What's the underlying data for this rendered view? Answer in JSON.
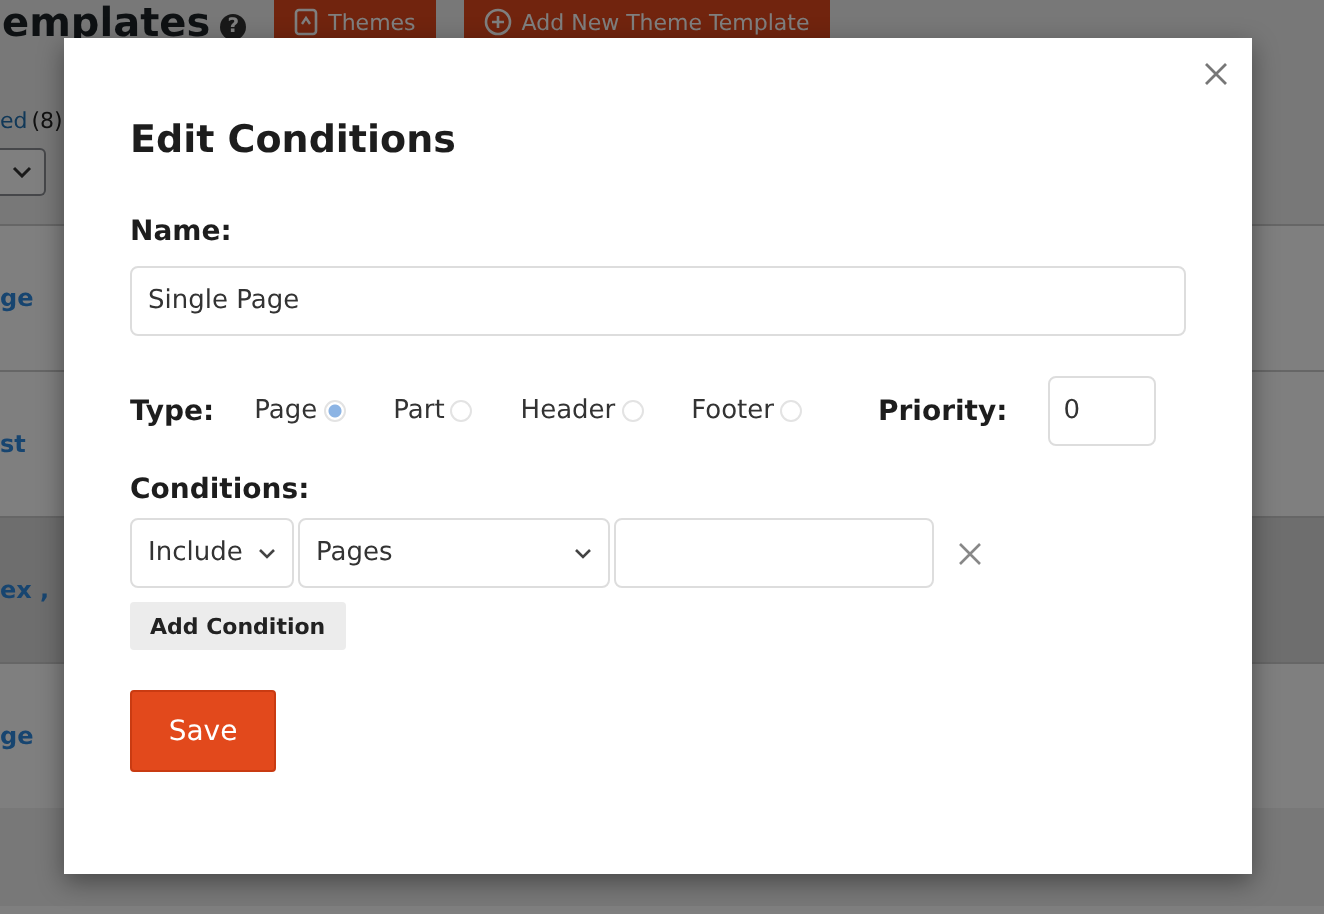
{
  "page": {
    "title": "emplates",
    "help_mark": "?",
    "buttons": [
      {
        "label": "Themes"
      },
      {
        "label": "Add New Theme Template"
      }
    ],
    "filter_link": "ed",
    "filter_count": "(8)",
    "rows": [
      {
        "title": "ge",
        "shaded": false
      },
      {
        "title": "st",
        "shaded": false
      },
      {
        "title": "ex ,",
        "shaded": true
      },
      {
        "title": "ge",
        "shaded": false
      }
    ]
  },
  "dialog": {
    "title": "Edit Conditions",
    "name_label": "Name:",
    "name_value": "Single Page",
    "type_label": "Type:",
    "types": [
      {
        "label": "Page",
        "selected": true
      },
      {
        "label": "Part",
        "selected": false
      },
      {
        "label": "Header",
        "selected": false
      },
      {
        "label": "Footer",
        "selected": false
      }
    ],
    "priority_label": "Priority:",
    "priority_value": "0",
    "conditions_label": "Conditions:",
    "conditions": [
      {
        "mode": "Include",
        "target": "Pages"
      }
    ],
    "add_button": "Add Condition",
    "save_button": "Save"
  }
}
